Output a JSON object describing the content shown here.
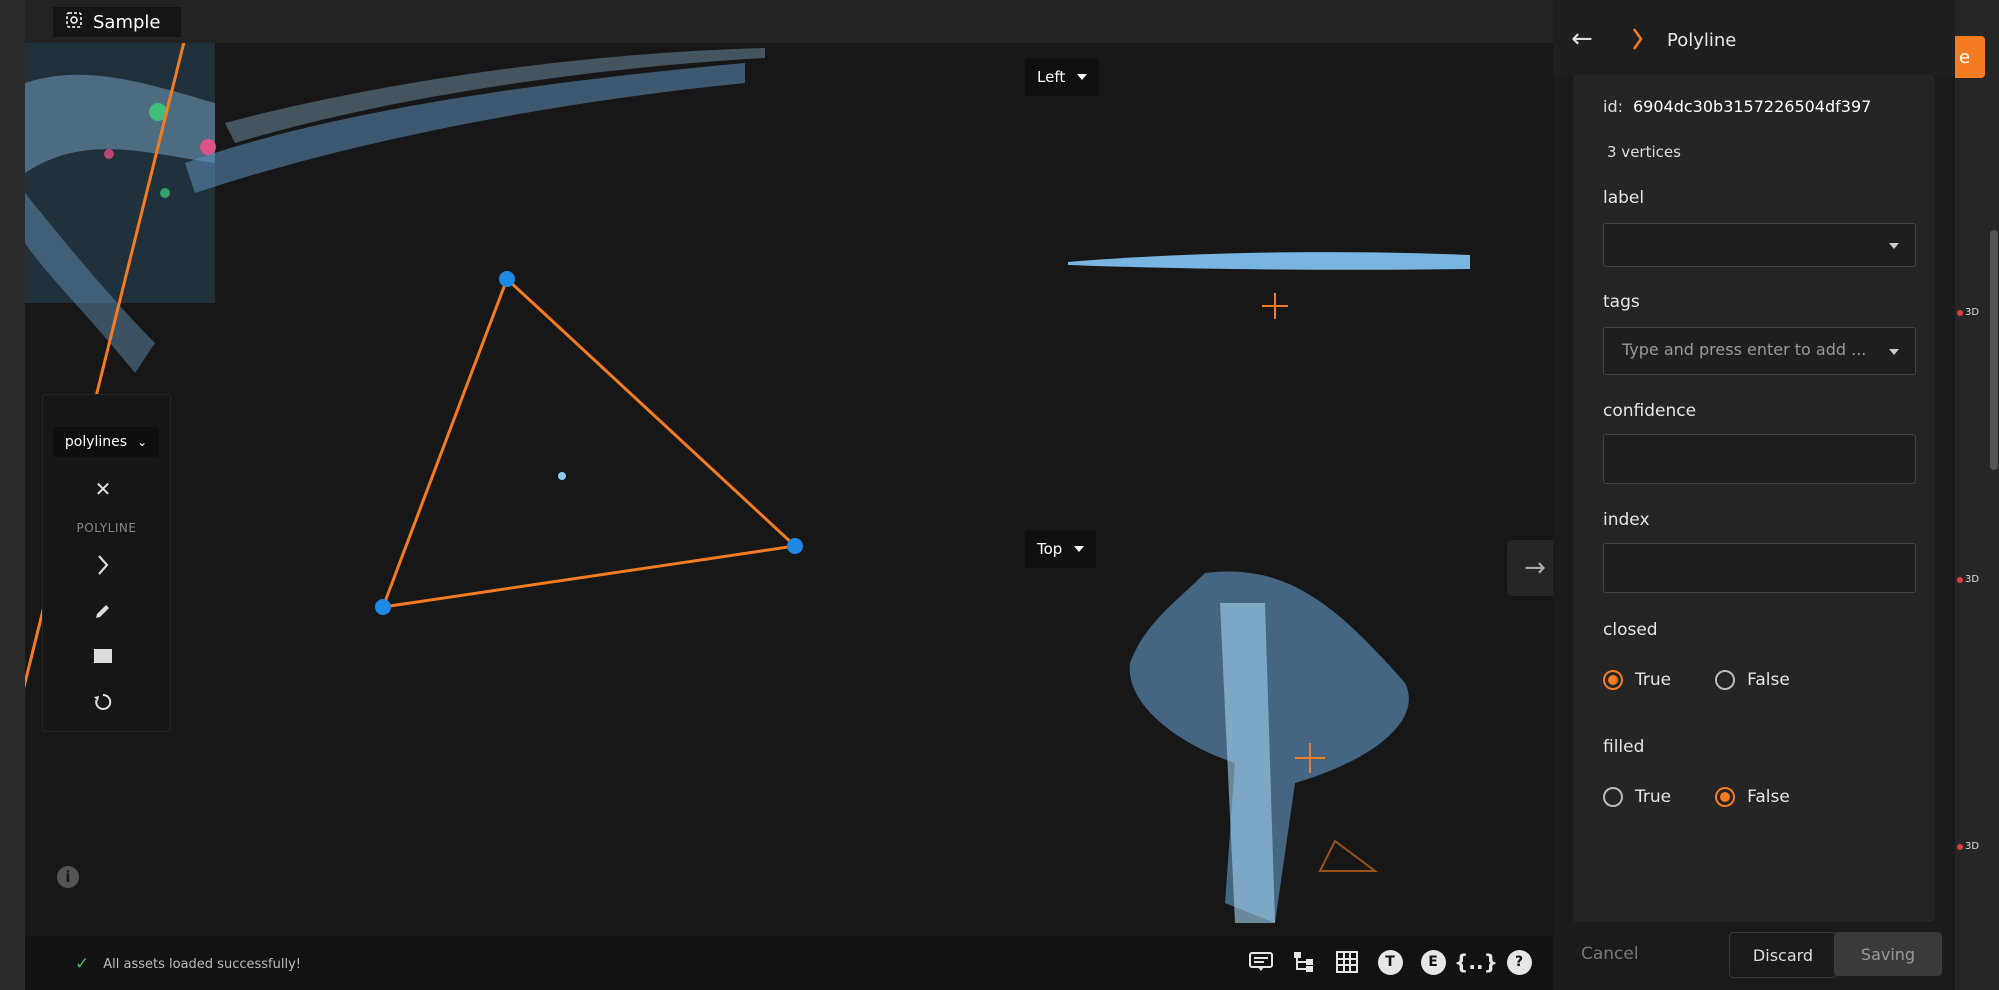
{
  "tab": {
    "title": "Sample"
  },
  "viewer": {
    "left_view_label": "Left",
    "top_view_label": "Top",
    "mode_select": "polylines",
    "tool_label": "POLYLINE",
    "status_message": "All assets loaded successfully!",
    "accent_color": "#f47b20",
    "vertex_color": "#1e88e5"
  },
  "statusbar_icons": [
    "caption-icon",
    "hierarchy-icon",
    "grid-icon",
    "T",
    "E",
    "{..}",
    "?"
  ],
  "sidebar": {
    "title": "Polyline",
    "id_label": "id:",
    "id_value": "6904dc30b3157226504df397",
    "vertices": "3 vertices",
    "fields": {
      "label": {
        "name": "label",
        "value": ""
      },
      "tags": {
        "name": "tags",
        "placeholder": "Type and press enter to add ..."
      },
      "confidence": {
        "name": "confidence",
        "value": ""
      },
      "index": {
        "name": "index",
        "value": ""
      },
      "closed": {
        "name": "closed",
        "true_label": "True",
        "false_label": "False",
        "selected": "True"
      },
      "filled": {
        "name": "filled",
        "true_label": "True",
        "false_label": "False",
        "selected": "False"
      }
    },
    "buttons": {
      "cancel": "Cancel",
      "discard": "Discard",
      "saving": "Saving"
    }
  },
  "right_strip": {
    "button_fragment": "e",
    "badge": "3D"
  }
}
